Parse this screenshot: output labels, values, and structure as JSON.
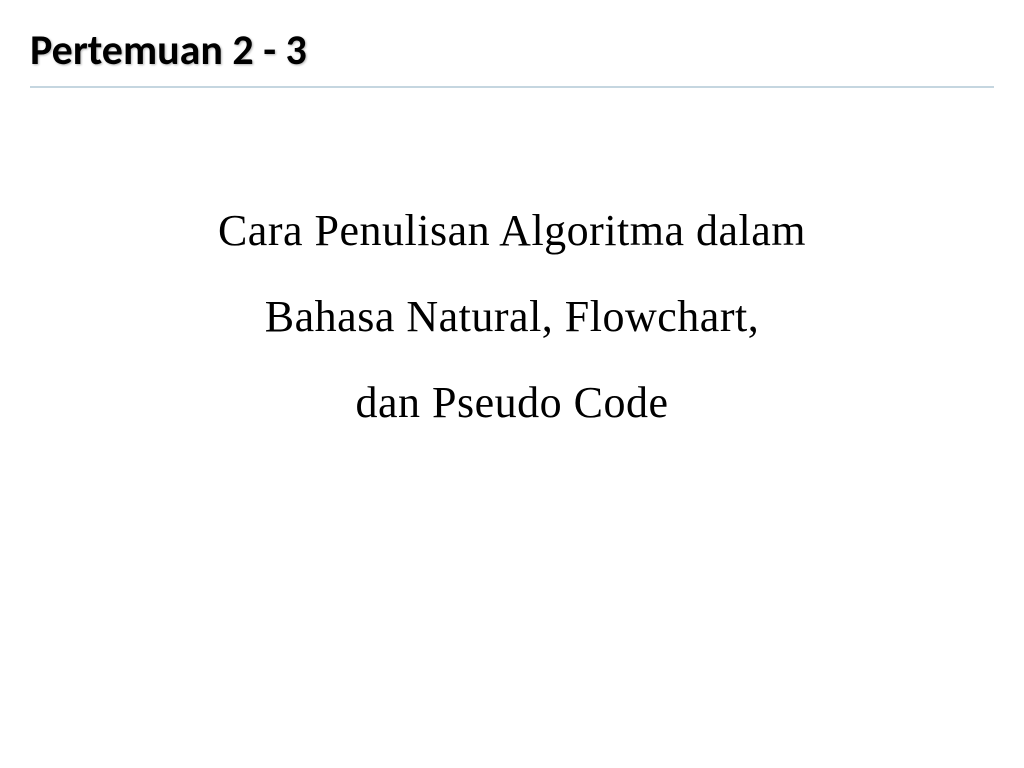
{
  "slide": {
    "title": "Pertemuan 2 - 3",
    "body_line1": "Cara Penulisan Algoritma dalam",
    "body_line2": "Bahasa Natural, Flowchart,",
    "body_line3": "dan Pseudo Code"
  }
}
